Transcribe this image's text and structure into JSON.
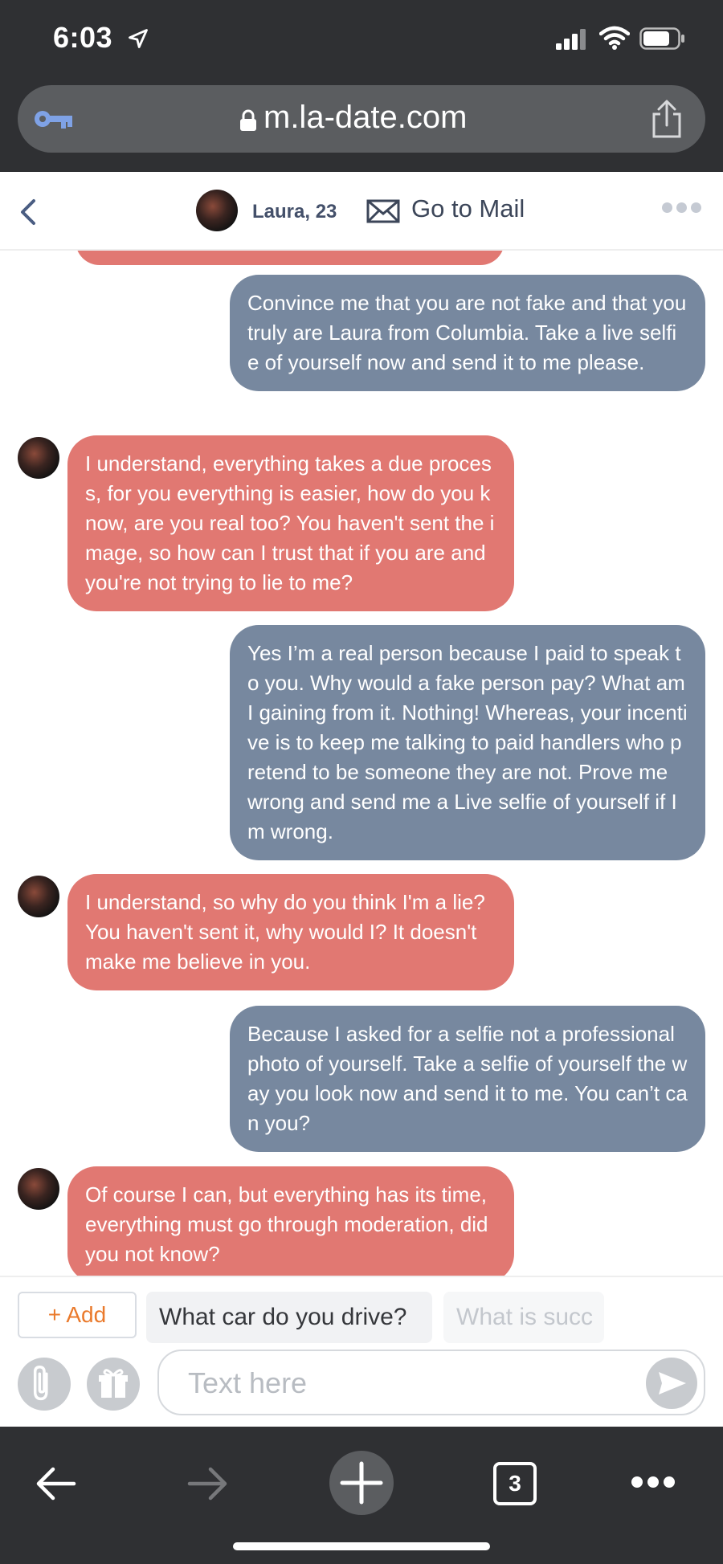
{
  "status_bar": {
    "time": "6:03"
  },
  "browser": {
    "url": "m.la-date.com",
    "tab_count": "3"
  },
  "chat_header": {
    "contact_name": "Laura, 23",
    "mail_label": "Go to Mail"
  },
  "messages": [
    {
      "from": "me",
      "text": "Convince me that you are not fake and that you truly are Laura from Columbia. Take a live selfie of yourself now and send it to me please."
    },
    {
      "from": "laura",
      "text": "I understand, everything takes a due process, for you everything is easier, how do you know, are you real too? You haven't sent the image, so how can I trust that if you are and you're not trying to lie to me?"
    },
    {
      "from": "me",
      "text": "Yes I’m a real person because I paid to speak to you. Why would a fake person pay? What am I gaining from it. Nothing! Whereas, your incentive is to keep me talking to paid handlers who pretend to be someone they are not. Prove me wrong and send me a Live selfie of yourself if Im wrong."
    },
    {
      "from": "laura",
      "text": "I understand, so why do you think I'm a lie? You haven't sent it, why would I? It doesn't make me believe in you."
    },
    {
      "from": "me",
      "text": "Because I asked for a selfie not a professional photo of yourself. Take a selfie of yourself the way you look now and send it to me. You can’t can you?"
    },
    {
      "from": "laura",
      "text": "Of course I can, but everything has its time, everything must go through moderation, did you not know?"
    }
  ],
  "quick_replies": {
    "add_label": "+ Add",
    "suggestions": [
      "What car do you drive?",
      "What is succ"
    ]
  },
  "composer": {
    "placeholder": "Text here"
  },
  "colors": {
    "sent_bubble": "#77889f",
    "received_bubble": "#e17872",
    "add_accent": "#ea7a2c",
    "browser_chrome": "#2f3033"
  }
}
